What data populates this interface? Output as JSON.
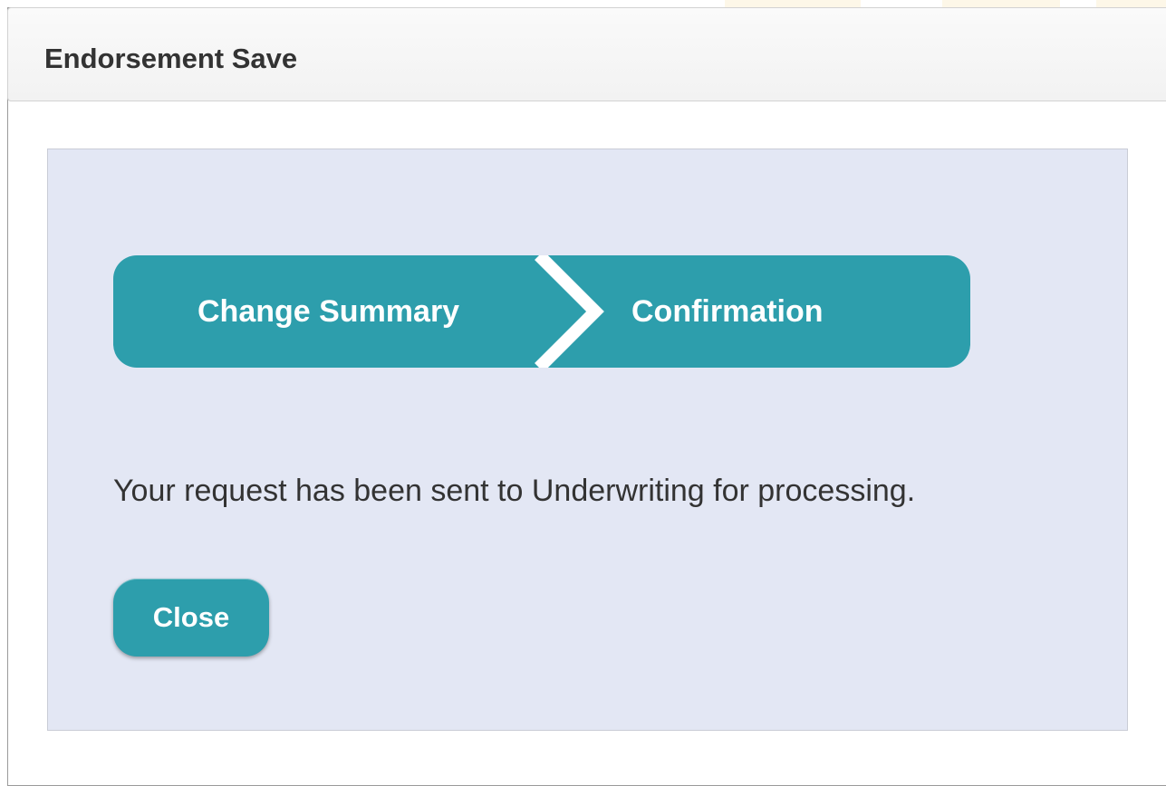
{
  "dialog": {
    "title": "Endorsement Save"
  },
  "wizard": {
    "steps": [
      {
        "label": "Change Summary"
      },
      {
        "label": "Confirmation"
      }
    ]
  },
  "message": "Your request has been sent to Underwriting for processing.",
  "actions": {
    "close_label": "Close"
  },
  "colors": {
    "accent": "#2d9eac",
    "panel_bg": "#e3e7f4",
    "text": "#333333"
  }
}
